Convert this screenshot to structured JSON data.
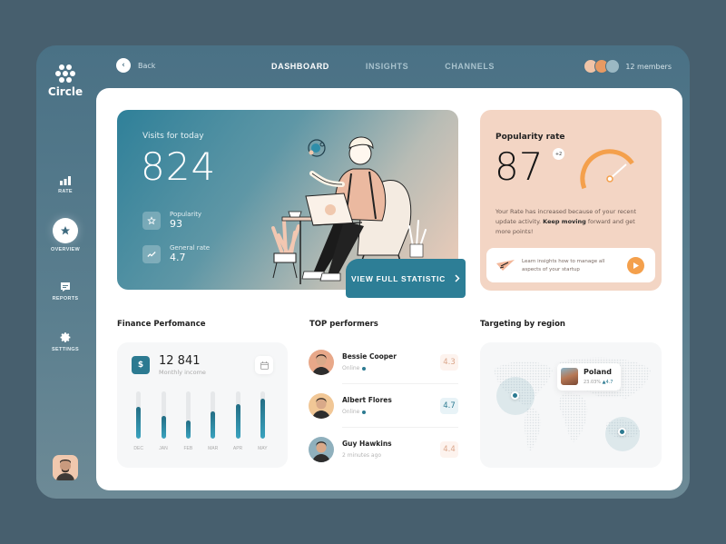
{
  "app": {
    "name": "Circle"
  },
  "topbar": {
    "back_label": "Back",
    "nav": [
      {
        "label": "DASHBOARD",
        "active": true
      },
      {
        "label": "INSIGHTS",
        "active": false
      },
      {
        "label": "CHANNELS",
        "active": false
      }
    ],
    "members_label": "12 members"
  },
  "sidebar": {
    "items": [
      {
        "label": "RATE",
        "icon": "bar-chart-icon"
      },
      {
        "label": "OVERVIEW",
        "icon": "star-icon",
        "active": true
      },
      {
        "label": "REPORTS",
        "icon": "message-icon"
      },
      {
        "label": "SETTINGS",
        "icon": "gear-icon"
      }
    ]
  },
  "visits": {
    "title": "Visits for today",
    "value": "824",
    "stats": [
      {
        "label": "Popularity",
        "value": "93",
        "icon": "star-icon"
      },
      {
        "label": "General rate",
        "value": "4.7",
        "icon": "trend-icon"
      }
    ],
    "button_label": "VIEW FULL STATISTIC"
  },
  "popularity": {
    "title": "Popularity rate",
    "value": "87",
    "delta": "+2",
    "gauge_fraction": 0.87,
    "text_before": "Your Rate has increased because of your recent update activity. ",
    "text_bold": "Keep moving",
    "text_after": " forward and get more points!",
    "learn_text": "Learn insights how to manage all aspects of your startup"
  },
  "finance": {
    "title": "Finance Perfomance",
    "value": "12 841",
    "subtitle": "Monthly income",
    "currency_symbol": "$",
    "bars": [
      {
        "label": "DEC",
        "fraction": 0.68
      },
      {
        "label": "JAN",
        "fraction": 0.48
      },
      {
        "label": "FEB",
        "fraction": 0.38
      },
      {
        "label": "MAR",
        "fraction": 0.58
      },
      {
        "label": "APR",
        "fraction": 0.74
      },
      {
        "label": "MAY",
        "fraction": 0.85
      }
    ]
  },
  "performers": {
    "title": "TOP performers",
    "items": [
      {
        "name": "Bessie Cooper",
        "status": "Online",
        "online": true,
        "score": "4.3",
        "score_color": "#d9a58a",
        "score_bg": "#fdf3ee",
        "avatar_bg": "#e8a889"
      },
      {
        "name": "Albert Flores",
        "status": "Online",
        "online": true,
        "score": "4.7",
        "score_color": "#2c7a91",
        "score_bg": "#e8f3f7",
        "avatar_bg": "#f1c796"
      },
      {
        "name": "Guy Hawkins",
        "status": "2 minutes ago",
        "online": false,
        "score": "4.4",
        "score_color": "#d9a58a",
        "score_bg": "#fdf3ee",
        "avatar_bg": "#8fb0bd"
      }
    ]
  },
  "region": {
    "title": "Targeting by region",
    "tooltip": {
      "country": "Poland",
      "share": "23.03%",
      "change": "▲4.7"
    }
  },
  "colors": {
    "accent": "#2c7a91",
    "orange": "#f4a04c",
    "peach": "#f3d5c4"
  }
}
